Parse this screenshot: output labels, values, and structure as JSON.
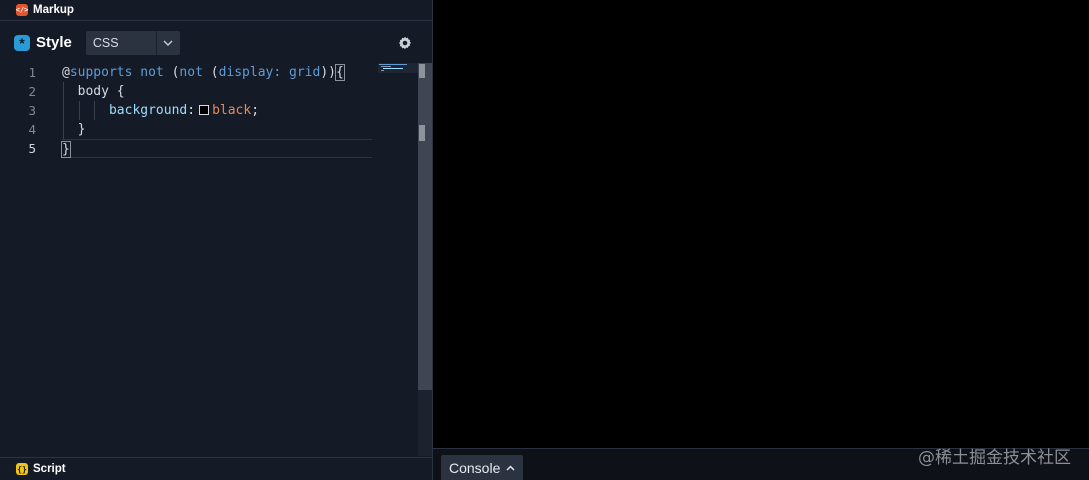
{
  "markup_panel": {
    "title": "Markup",
    "icon": "html-tag-icon"
  },
  "style_panel": {
    "title": "Style",
    "icon": "asterisk-icon",
    "language": "CSS",
    "settings_icon": "gear-icon"
  },
  "editor": {
    "line_numbers": [
      "1",
      "2",
      "3",
      "4",
      "5"
    ],
    "line1": {
      "at": "@",
      "supports": "supports",
      "not1": "not",
      "open": "(",
      "not2": "not",
      "open2": "(",
      "prop": "display",
      "colon": ":",
      "value": "grid",
      "close": "))",
      "brace": "{"
    },
    "line2": {
      "selector": "body",
      "brace": "{"
    },
    "line3": {
      "prop": "background",
      "colon": ":",
      "value": "black",
      "semi": ";"
    },
    "line4": {
      "brace": "}"
    },
    "line5": {
      "brace": "}"
    }
  },
  "script_panel": {
    "title": "Script",
    "icon": "braces-icon"
  },
  "console": {
    "label": "Console",
    "chevron_icon": "chevron-up-icon"
  },
  "watermark": "@稀土掘金技术社区",
  "colors": {
    "editor_bg": "#151b26",
    "preview_bg": "#000000",
    "keyword": "#5f9bd6",
    "property": "#9cdcfe",
    "value": "#e58a5a"
  }
}
